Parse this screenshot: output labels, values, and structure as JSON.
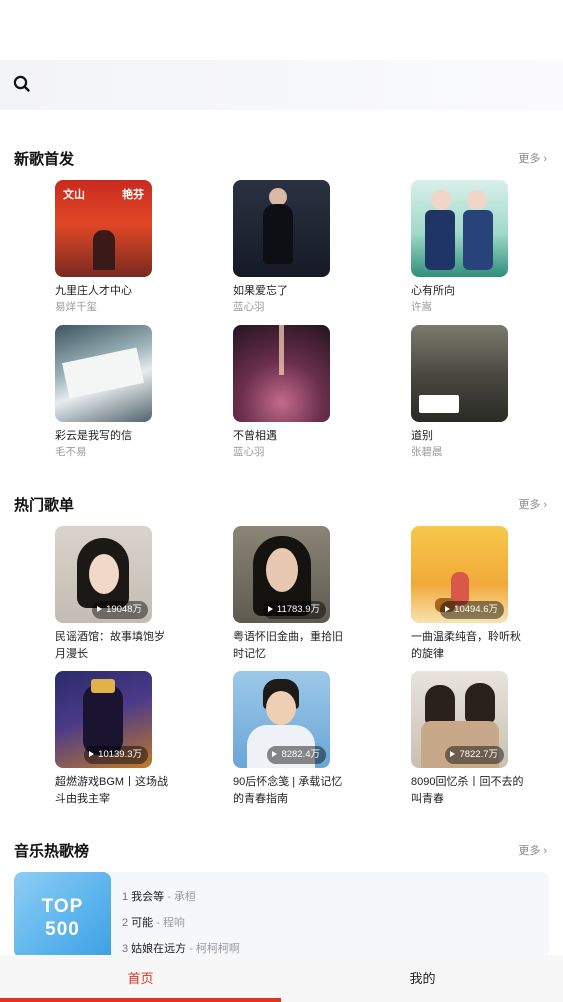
{
  "search": {
    "icon": "search-icon"
  },
  "new_songs": {
    "title": "新歌首发",
    "more": "更多",
    "items": [
      {
        "title": "九里庄人才中心",
        "artist": "易烊千玺"
      },
      {
        "title": "如果爱忘了",
        "artist": "蓝心羽"
      },
      {
        "title": "心有所向",
        "artist": "许嵩"
      },
      {
        "title": "彩云是我写的信",
        "artist": "毛不易"
      },
      {
        "title": "不曾相遇",
        "artist": "蓝心羽"
      },
      {
        "title": "道别",
        "artist": "张碧晨"
      }
    ]
  },
  "hot_playlists": {
    "title": "热门歌单",
    "more": "更多",
    "items": [
      {
        "title": "民谣酒馆：故事填饱岁月漫长",
        "plays": "19048万"
      },
      {
        "title": "粤语怀旧金曲，重拾旧时记忆",
        "plays": "11783.9万"
      },
      {
        "title": "一曲温柔纯音，聆听秋的旋律",
        "plays": "10494.6万"
      },
      {
        "title": "超燃游戏BGM丨这场战斗由我主宰",
        "plays": "10139.3万"
      },
      {
        "title": "90后怀念笺 | 承载记忆的青春指南",
        "plays": "8282.4万"
      },
      {
        "title": "8090回忆杀丨回不去的叫青春",
        "plays": "7822.7万"
      }
    ]
  },
  "hot_chart": {
    "title": "音乐热歌榜",
    "more": "更多",
    "cover_line1": "TOP",
    "cover_line2": "500",
    "ranks": [
      {
        "num": "1",
        "song": "我会等",
        "artist": "- 承桓"
      },
      {
        "num": "2",
        "song": "可能",
        "artist": "- 程响"
      },
      {
        "num": "3",
        "song": "姑娘在远方",
        "artist": "- 柯柯柯啊"
      }
    ]
  },
  "tabs": {
    "home": "首页",
    "mine": "我的"
  },
  "colors": {
    "accent": "#e0321f",
    "muted": "#9a9a9a"
  }
}
